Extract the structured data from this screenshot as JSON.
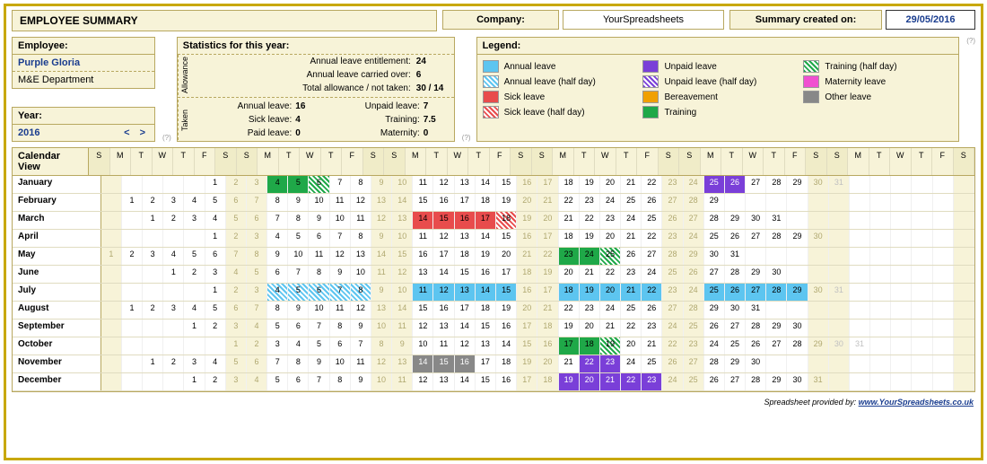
{
  "title": "EMPLOYEE SUMMARY",
  "company_label": "Company:",
  "company_value": "YourSpreadsheets",
  "date_label": "Summary created on:",
  "date_value": "29/05/2016",
  "employee": {
    "label": "Employee:",
    "name": "Purple Gloria",
    "dept": "M&E Department"
  },
  "year": {
    "label": "Year:",
    "value": "2016",
    "nav": "<   >"
  },
  "help": "(?)",
  "stats": {
    "title": "Statistics for this year:",
    "allowance_label": "Allowance",
    "taken_label": "Taken",
    "rows_allowance": [
      {
        "l": "Annual leave entitlement:",
        "v": "24"
      },
      {
        "l": "Annual leave carried over:",
        "v": "6"
      },
      {
        "l": "Total allowance / not taken:",
        "v": "30 / 14"
      }
    ],
    "rows_taken": [
      {
        "l1": "Annual leave:",
        "v1": "16",
        "l2": "Unpaid leave:",
        "v2": "7"
      },
      {
        "l1": "Sick leave:",
        "v1": "4",
        "l2": "Training:",
        "v2": "7.5"
      },
      {
        "l1": "Paid leave:",
        "v1": "0",
        "l2": "Maternity:",
        "v2": "0"
      }
    ]
  },
  "legend": {
    "title": "Legend:",
    "items": [
      {
        "cls": "s-annual",
        "label": "Annual leave"
      },
      {
        "cls": "s-unpaid",
        "label": "Unpaid leave"
      },
      {
        "cls": "s-training-h",
        "label": "Training (half day)"
      },
      {
        "cls": "s-annual-h",
        "label": "Annual leave (half day)"
      },
      {
        "cls": "s-unpaid-h",
        "label": "Unpaid leave (half day)"
      },
      {
        "cls": "s-maternity",
        "label": "Maternity leave"
      },
      {
        "cls": "s-sick",
        "label": "Sick leave"
      },
      {
        "cls": "s-bereave",
        "label": "Bereavement"
      },
      {
        "cls": "s-other",
        "label": "Other leave"
      },
      {
        "cls": "s-sick-h",
        "label": "Sick leave (half day)"
      },
      {
        "cls": "s-training",
        "label": "Training"
      }
    ]
  },
  "calendar": {
    "title": "Calendar View",
    "day_heads": [
      "S",
      "M",
      "T",
      "W",
      "T",
      "F",
      "S",
      "S",
      "M",
      "T",
      "W",
      "T",
      "F",
      "S",
      "S",
      "M",
      "T",
      "W",
      "T",
      "F",
      "S",
      "S",
      "M",
      "T",
      "W",
      "T",
      "F",
      "S",
      "S",
      "M",
      "T",
      "W",
      "T",
      "F",
      "S",
      "S",
      "M",
      "T",
      "W",
      "T",
      "F",
      "S"
    ],
    "wknd_cols": [
      0,
      6,
      7,
      13,
      14,
      20,
      21,
      27,
      28,
      34,
      35,
      41
    ],
    "months": [
      {
        "name": "January",
        "start": 5,
        "days": 31,
        "marks": {
          "4": "training",
          "5": "training",
          "6": "training-h",
          "25": "unpaid",
          "26": "unpaid"
        }
      },
      {
        "name": "February",
        "start": 1,
        "days": 29,
        "marks": {}
      },
      {
        "name": "March",
        "start": 2,
        "days": 31,
        "marks": {
          "14": "sick",
          "15": "sick",
          "16": "sick",
          "17": "sick",
          "18": "sick-h"
        }
      },
      {
        "name": "April",
        "start": 5,
        "days": 30,
        "marks": {}
      },
      {
        "name": "May",
        "start": 0,
        "days": 31,
        "marks": {
          "23": "training",
          "24": "training",
          "25": "training-h"
        }
      },
      {
        "name": "June",
        "start": 3,
        "days": 30,
        "marks": {}
      },
      {
        "name": "July",
        "start": 5,
        "days": 31,
        "marks": {
          "4": "annual-h",
          "5": "annual-h",
          "6": "annual-h",
          "7": "annual-h",
          "8": "annual-h",
          "11": "annual",
          "12": "annual",
          "13": "annual",
          "14": "annual",
          "15": "annual",
          "18": "annual",
          "19": "annual",
          "20": "annual",
          "21": "annual",
          "22": "annual",
          "25": "annual",
          "26": "annual",
          "27": "annual",
          "28": "annual",
          "29": "annual"
        }
      },
      {
        "name": "August",
        "start": 1,
        "days": 31,
        "marks": {}
      },
      {
        "name": "September",
        "start": 4,
        "days": 30,
        "marks": {}
      },
      {
        "name": "October",
        "start": 6,
        "days": 31,
        "marks": {
          "17": "training",
          "18": "training",
          "19": "training-h"
        }
      },
      {
        "name": "November",
        "start": 2,
        "days": 30,
        "marks": {
          "14": "other",
          "15": "other",
          "16": "other",
          "22": "unpaid",
          "23": "unpaid"
        }
      },
      {
        "name": "December",
        "start": 4,
        "days": 31,
        "marks": {
          "19": "unpaid",
          "20": "unpaid",
          "21": "unpaid",
          "22": "unpaid",
          "23": "unpaid"
        }
      }
    ]
  },
  "footer": {
    "text": "Spreadsheet provided by:",
    "link": "www.YourSpreadsheets.co.uk"
  }
}
